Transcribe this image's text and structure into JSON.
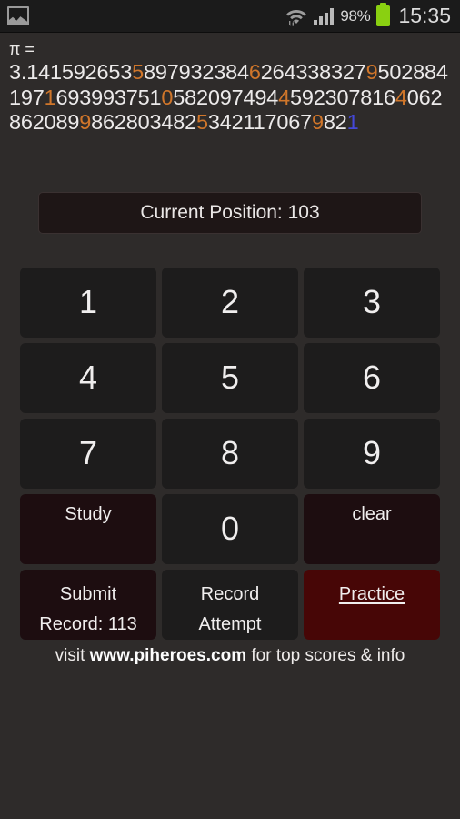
{
  "statusbar": {
    "gallery_icon": "gallery-icon",
    "wifi_icon": "wifi-icon",
    "signal_icon": "signal-bars-icon",
    "battery_percent": "98%",
    "battery_icon": "battery-icon",
    "clock": "15:35"
  },
  "pi": {
    "label": "π =",
    "prefix": "3.",
    "digits": "141592653589793238462643383279502884197169399375105820974944592307816406286208998628034825342117067 9821",
    "digit_string": "1415926535897932384626433832795028841971693993751058209749445923078164062862089986280348253421170679821",
    "highlight_every": 10,
    "highlight_color": "#d0762a",
    "current_position_index": 103,
    "current_digit_color": "#4448d8"
  },
  "position": {
    "label": "Current Position: 103"
  },
  "keypad": {
    "rows": [
      [
        "1",
        "2",
        "3"
      ],
      [
        "4",
        "5",
        "6"
      ],
      [
        "7",
        "8",
        "9"
      ]
    ],
    "study_label": "Study",
    "zero_label": "0",
    "clear_label": "clear",
    "submit_line1": "Submit",
    "submit_line2": "Record: 113",
    "record_line1": "Record",
    "record_line2": "Attempt",
    "practice_label": "Practice"
  },
  "footer": {
    "before": "visit ",
    "url": "www.piheroes.com",
    "after": " for top scores & info"
  },
  "colors": {
    "background": "#2e2b2a",
    "key": "#1d1c1c",
    "key_red_dark": "#1d0d10",
    "key_red_bright": "#470606",
    "accent_orange": "#d0762a",
    "accent_blue": "#4448d8",
    "battery_green": "#8ad011"
  }
}
